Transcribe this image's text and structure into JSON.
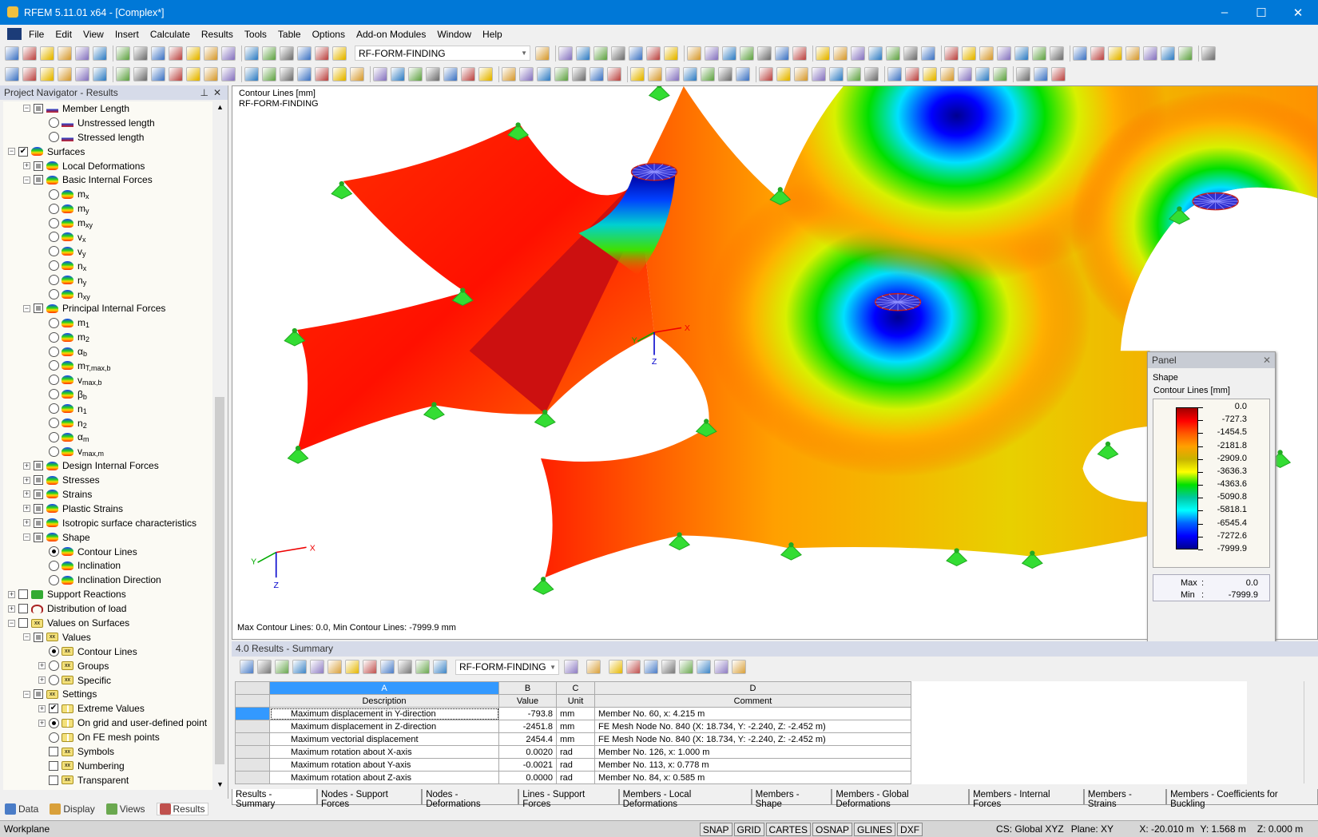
{
  "window": {
    "title": "RFEM 5.11.01 x64 - [Complex*]",
    "minimize": "–",
    "maximize": "☐",
    "close": "✕"
  },
  "menu": [
    "File",
    "Edit",
    "View",
    "Insert",
    "Calculate",
    "Results",
    "Tools",
    "Table",
    "Options",
    "Add-on Modules",
    "Window",
    "Help"
  ],
  "toolbar": {
    "loadcase": "RF-FORM-FINDING"
  },
  "navigator": {
    "title": "Project Navigator - Results",
    "tabs": [
      "Data",
      "Display",
      "Views",
      "Results"
    ],
    "items": [
      {
        "lv": 2,
        "exp": "-",
        "ctl": "gray",
        "icon": "ml",
        "label": "Member Length"
      },
      {
        "lv": 3,
        "ctl": "radio",
        "icon": "ml",
        "label": "Unstressed length"
      },
      {
        "lv": 3,
        "ctl": "radio",
        "icon": "ml",
        "label": "Stressed length"
      },
      {
        "lv": 1,
        "exp": "-",
        "ctl": "checked",
        "icon": "surf",
        "label": "Surfaces"
      },
      {
        "lv": 2,
        "exp": "+",
        "ctl": "gray",
        "icon": "surf",
        "label": "Local Deformations"
      },
      {
        "lv": 2,
        "exp": "-",
        "ctl": "gray",
        "icon": "surf",
        "label": "Basic Internal Forces"
      },
      {
        "lv": 3,
        "ctl": "radio",
        "icon": "surf",
        "label": "m",
        "sub": "x"
      },
      {
        "lv": 3,
        "ctl": "radio",
        "icon": "surf",
        "label": "m",
        "sub": "y"
      },
      {
        "lv": 3,
        "ctl": "radio",
        "icon": "surf",
        "label": "m",
        "sub": "xy"
      },
      {
        "lv": 3,
        "ctl": "radio",
        "icon": "surf",
        "label": "v",
        "sub": "x"
      },
      {
        "lv": 3,
        "ctl": "radio",
        "icon": "surf",
        "label": "v",
        "sub": "y"
      },
      {
        "lv": 3,
        "ctl": "radio",
        "icon": "surf",
        "label": "n",
        "sub": "x"
      },
      {
        "lv": 3,
        "ctl": "radio",
        "icon": "surf",
        "label": "n",
        "sub": "y"
      },
      {
        "lv": 3,
        "ctl": "radio",
        "icon": "surf",
        "label": "n",
        "sub": "xy"
      },
      {
        "lv": 2,
        "exp": "-",
        "ctl": "gray",
        "icon": "surf",
        "label": "Principal Internal Forces"
      },
      {
        "lv": 3,
        "ctl": "radio",
        "icon": "surf",
        "label": "m",
        "sub": "1"
      },
      {
        "lv": 3,
        "ctl": "radio",
        "icon": "surf",
        "label": "m",
        "sub": "2"
      },
      {
        "lv": 3,
        "ctl": "radio",
        "icon": "surf",
        "label": "α",
        "sub": "b"
      },
      {
        "lv": 3,
        "ctl": "radio",
        "icon": "surf",
        "label": "m",
        "sub": "T,max,b"
      },
      {
        "lv": 3,
        "ctl": "radio",
        "icon": "surf",
        "label": "v",
        "sub": "max,b"
      },
      {
        "lv": 3,
        "ctl": "radio",
        "icon": "surf",
        "label": "β",
        "sub": "b"
      },
      {
        "lv": 3,
        "ctl": "radio",
        "icon": "surf",
        "label": "n",
        "sub": "1"
      },
      {
        "lv": 3,
        "ctl": "radio",
        "icon": "surf",
        "label": "n",
        "sub": "2"
      },
      {
        "lv": 3,
        "ctl": "radio",
        "icon": "surf",
        "label": "α",
        "sub": "m"
      },
      {
        "lv": 3,
        "ctl": "radio",
        "icon": "surf",
        "label": "v",
        "sub": "max,m"
      },
      {
        "lv": 2,
        "exp": "+",
        "ctl": "gray",
        "icon": "surf",
        "label": "Design Internal Forces"
      },
      {
        "lv": 2,
        "exp": "+",
        "ctl": "gray",
        "icon": "surf",
        "label": "Stresses"
      },
      {
        "lv": 2,
        "exp": "+",
        "ctl": "gray",
        "icon": "surf",
        "label": "Strains"
      },
      {
        "lv": 2,
        "exp": "+",
        "ctl": "gray",
        "icon": "surf",
        "label": "Plastic Strains"
      },
      {
        "lv": 2,
        "exp": "+",
        "ctl": "gray",
        "icon": "surf",
        "label": "Isotropic surface characteristics"
      },
      {
        "lv": 2,
        "exp": "-",
        "ctl": "gray",
        "icon": "surf",
        "label": "Shape"
      },
      {
        "lv": 3,
        "ctl": "radio-on",
        "icon": "surf",
        "label": "Contour Lines"
      },
      {
        "lv": 3,
        "ctl": "radio",
        "icon": "surf",
        "label": "Inclination"
      },
      {
        "lv": 3,
        "ctl": "radio",
        "icon": "surf",
        "label": "Inclination Direction"
      },
      {
        "lv": 1,
        "exp": "+",
        "ctl": "empty",
        "icon": "support",
        "label": "Support Reactions"
      },
      {
        "lv": 1,
        "exp": "+",
        "ctl": "empty",
        "icon": "load",
        "label": "Distribution of load"
      },
      {
        "lv": 1,
        "exp": "-",
        "ctl": "empty",
        "icon": "xx",
        "label": "Values on Surfaces"
      },
      {
        "lv": 2,
        "exp": "-",
        "ctl": "gray",
        "icon": "xx",
        "label": "Values"
      },
      {
        "lv": 3,
        "ctl": "radio-on",
        "icon": "xx",
        "label": "Contour Lines"
      },
      {
        "lv": 3,
        "exp": "+",
        "ctl": "radio",
        "icon": "xx",
        "label": "Groups"
      },
      {
        "lv": 3,
        "exp": "+",
        "ctl": "radio",
        "icon": "xx",
        "label": "Specific"
      },
      {
        "lv": 2,
        "exp": "-",
        "ctl": "gray",
        "icon": "xx",
        "label": "Settings"
      },
      {
        "lv": 3,
        "exp": "+",
        "ctl": "checked",
        "icon": "grid",
        "label": "Extreme Values"
      },
      {
        "lv": 3,
        "exp": "+",
        "ctl": "radio-on",
        "icon": "grid",
        "label": "On grid and user-defined point"
      },
      {
        "lv": 3,
        "ctl": "radio",
        "icon": "grid",
        "label": "On FE mesh points"
      },
      {
        "lv": 3,
        "ctl": "empty",
        "icon": "xx",
        "label": "Symbols"
      },
      {
        "lv": 3,
        "ctl": "empty",
        "icon": "xx",
        "label": "Numbering"
      },
      {
        "lv": 3,
        "ctl": "empty",
        "icon": "xx",
        "label": "Transparent"
      }
    ]
  },
  "viewport": {
    "title": "Contour Lines [mm]",
    "loadcase": "RF-FORM-FINDING",
    "footer": "Max Contour Lines: 0.0, Min Contour Lines: -7999.9 mm",
    "axes": {
      "x": "X",
      "y": "Y",
      "z": "Z"
    }
  },
  "panel": {
    "title": "Panel",
    "close": "✕",
    "heading": "Shape",
    "subheading": "Contour Lines [mm]",
    "legend": [
      "0.0",
      "-727.3",
      "-1454.5",
      "-2181.8",
      "-2909.0",
      "-3636.3",
      "-4363.6",
      "-5090.8",
      "-5818.1",
      "-6545.4",
      "-7272.6",
      "-7999.9"
    ],
    "colors": [
      "#a00000",
      "#ff0000",
      "#ff5a00",
      "#ffa000",
      "#c8b400",
      "#ffff00",
      "#00e000",
      "#00c8a0",
      "#00ffff",
      "#0064ff",
      "#0000ff",
      "#000090"
    ],
    "max_label": "Max",
    "max": "0.0",
    "min_label": "Min",
    "min": "-7999.9"
  },
  "results": {
    "title": "4.0 Results - Summary",
    "loadcase": "RF-FORM-FINDING",
    "col_letters": [
      "A",
      "B",
      "C",
      "D"
    ],
    "col_headers": [
      "Description",
      "Value",
      "Unit",
      "Comment"
    ],
    "rows": [
      [
        "Maximum displacement in Y-direction",
        "-793.8",
        "mm",
        "Member No. 60,  x: 4.215 m"
      ],
      [
        "Maximum displacement in Z-direction",
        "-2451.8",
        "mm",
        "FE Mesh Node No. 840  (X: 18.734,  Y: -2.240,  Z: -2.452 m)"
      ],
      [
        "Maximum vectorial displacement",
        "2454.4",
        "mm",
        "FE Mesh Node No. 840  (X: 18.734,  Y: -2.240,  Z: -2.452 m)"
      ],
      [
        "Maximum rotation about X-axis",
        "0.0020",
        "rad",
        "Member No. 126,  x: 1.000 m"
      ],
      [
        "Maximum rotation about Y-axis",
        "-0.0021",
        "rad",
        "Member No. 113,  x: 0.778 m"
      ],
      [
        "Maximum rotation about Z-axis",
        "0.0000",
        "rad",
        "Member No. 84,  x: 0.585 m"
      ]
    ],
    "tabs": [
      "Results - Summary",
      "Nodes - Support Forces",
      "Nodes - Deformations",
      "Lines - Support Forces",
      "Members - Local Deformations",
      "Members - Shape",
      "Members - Global Deformations",
      "Members - Internal Forces",
      "Members - Strains",
      "Members - Coefficients for Buckling"
    ]
  },
  "status": {
    "workplane": "Workplane",
    "buttons": [
      "SNAP",
      "GRID",
      "CARTES",
      "OSNAP",
      "GLINES",
      "DXF"
    ],
    "cs": "CS: Global XYZ",
    "plane": "Plane: XY",
    "x": "X:  -20.010 m",
    "y": "Y:  1.568 m",
    "z": "Z:  0.000 m"
  }
}
